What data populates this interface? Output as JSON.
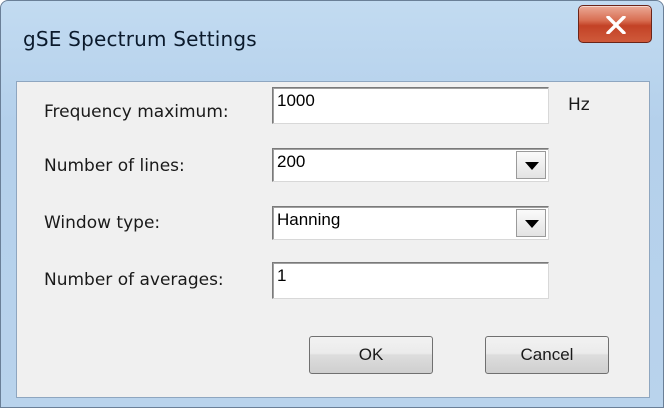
{
  "window": {
    "title": "gSE Spectrum Settings"
  },
  "form": {
    "frequency_maximum": {
      "label": "Frequency maximum:",
      "value": "1000",
      "unit": "Hz"
    },
    "number_of_lines": {
      "label": "Number of lines:",
      "value": "200"
    },
    "window_type": {
      "label": "Window type:",
      "value": "Hanning"
    },
    "number_of_averages": {
      "label": "Number of averages:",
      "value": "1"
    }
  },
  "buttons": {
    "ok": "OK",
    "cancel": "Cancel"
  },
  "icons": {
    "close": "close-icon",
    "dropdown": "chevron-down-icon"
  },
  "colors": {
    "close_button": "#c74a2e",
    "title_bar": "#b9d3ec",
    "client_background": "#f0f0f0"
  }
}
